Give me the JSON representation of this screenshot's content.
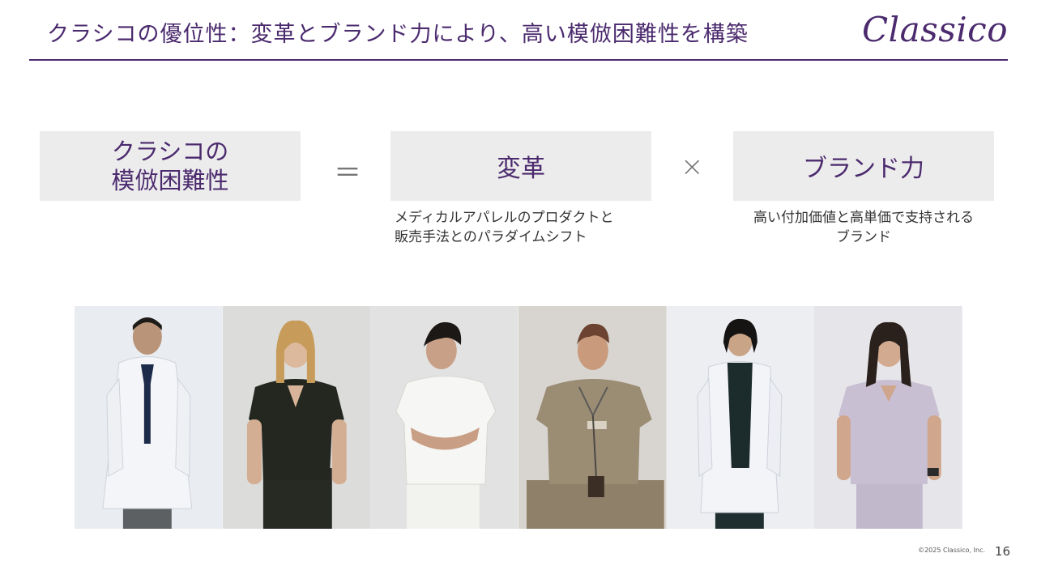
{
  "header": {
    "title": "クラシコの優位性：変革とブランド力により、高い模倣困難性を構築",
    "logo_text": "Classico"
  },
  "equation": {
    "left_line1": "クラシコの",
    "left_line2": "模倣困難性",
    "equals_symbol": "＝",
    "middle_label": "変革",
    "times_symbol": "×",
    "right_label": "ブランド力",
    "middle_caption_line1": "メディカルアパレルのプロダクトと",
    "middle_caption_line2": "販売手法とのパラダイムシフト",
    "right_caption_line1": "高い付加価値と高単価で支持される",
    "right_caption_line2": "ブランド"
  },
  "photos": [
    {
      "garment": "white lab coat, navy tie",
      "background": "#e9ecf0",
      "garment_color": "#f4f5f8"
    },
    {
      "garment": "black scrubs",
      "background": "#dcdcda",
      "garment_color": "#23271f"
    },
    {
      "garment": "white scrubs",
      "background": "#e2e2e2",
      "garment_color": "#f6f6f4"
    },
    {
      "garment": "khaki scrubs, lanyard",
      "background": "#d8d5d0",
      "garment_color": "#9b8c74"
    },
    {
      "garment": "white lab coat, black turtleneck",
      "background": "#eceef1",
      "garment_color": "#f2f4f8"
    },
    {
      "garment": "lavender scrubs",
      "background": "#e6e6ea",
      "garment_color": "#c8bfd2"
    }
  ],
  "footer": {
    "copyright": "©2025 Classico, Inc.",
    "page_number": "16"
  },
  "colors": {
    "accent": "#4b2a6e",
    "box_background": "#ececec"
  }
}
